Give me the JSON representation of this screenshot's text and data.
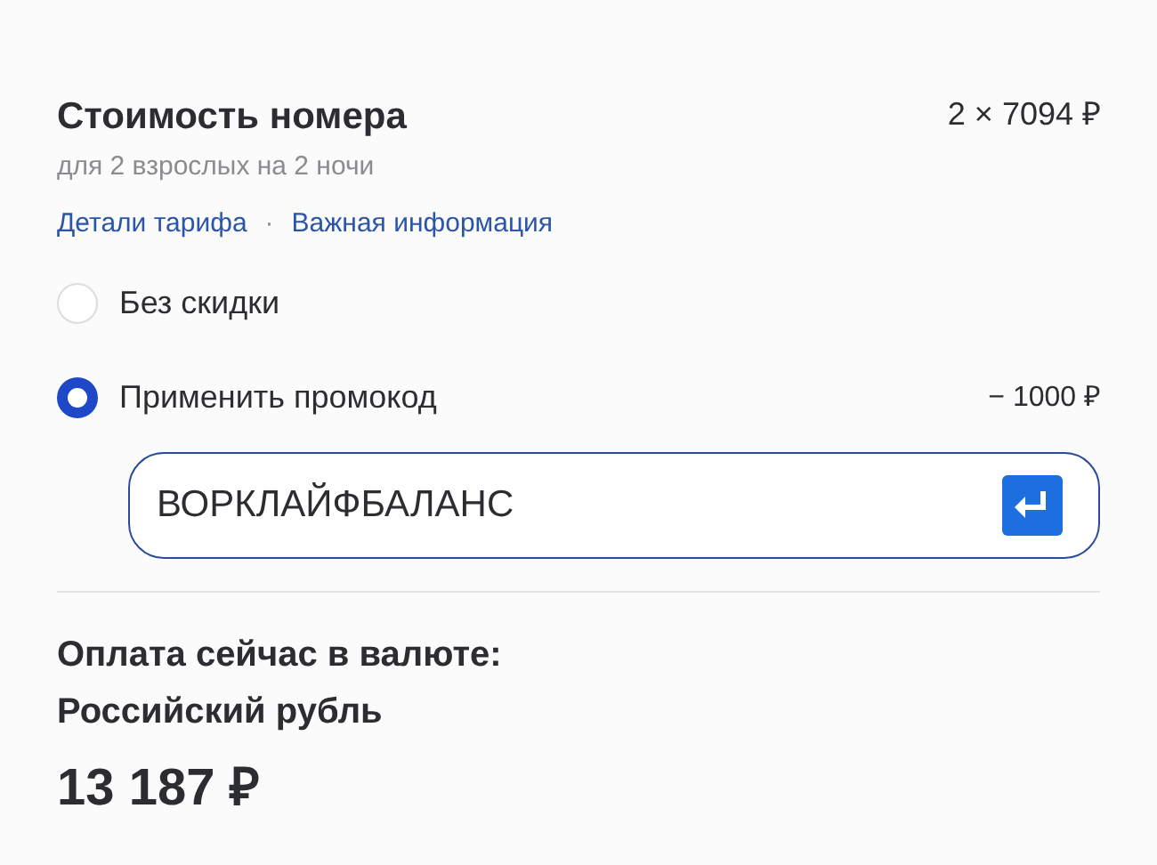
{
  "price": {
    "title": "Стоимость номера",
    "amount": "2 × 7094 ₽",
    "subtitle": "для 2 взрослых на 2 ночи"
  },
  "links": [
    {
      "label": "Детали тарифа"
    },
    {
      "label": "Важная информация"
    }
  ],
  "link_separator": "·",
  "options": [
    {
      "label": "Без скидки",
      "selected": false
    },
    {
      "label": "Применить промокод",
      "selected": true,
      "discount": "− 1000 ₽"
    }
  ],
  "promo_field": {
    "value": "ВОРКЛАЙФБАЛАНС"
  },
  "payment": {
    "label": "Оплата сейчас в валюте:",
    "currency": "Российский рубль",
    "total": "13 187 ₽"
  }
}
